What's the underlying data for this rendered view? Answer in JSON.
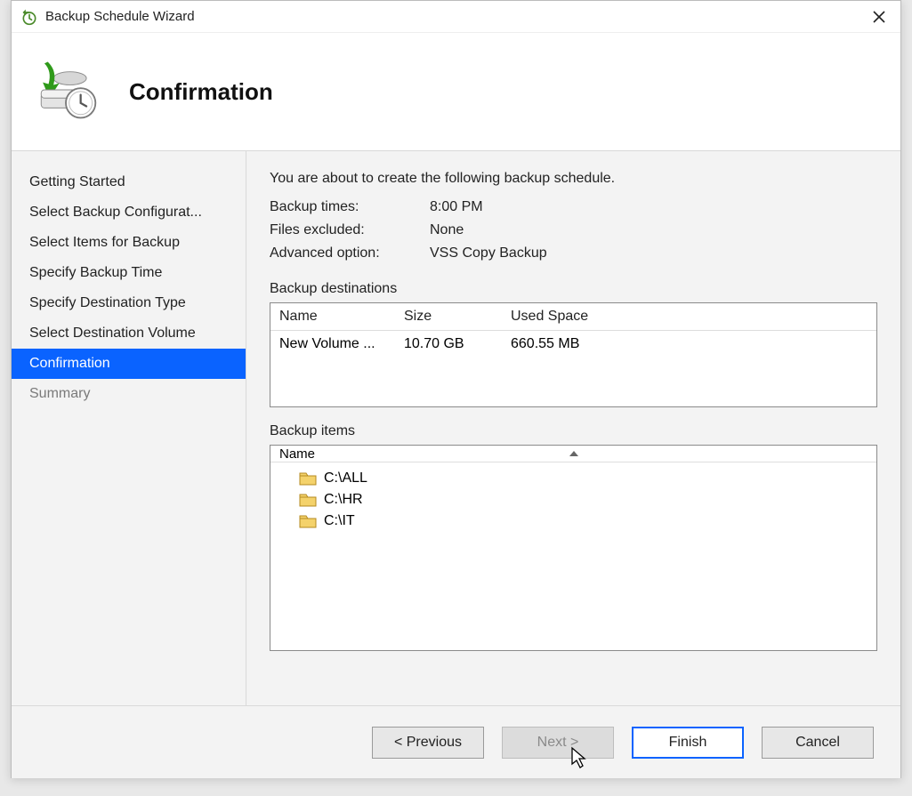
{
  "window": {
    "title": "Backup Schedule Wizard"
  },
  "header": {
    "title": "Confirmation"
  },
  "nav": {
    "steps": [
      {
        "label": "Getting Started",
        "state": "done"
      },
      {
        "label": "Select Backup Configurat...",
        "state": "done"
      },
      {
        "label": "Select Items for Backup",
        "state": "done"
      },
      {
        "label": "Specify Backup Time",
        "state": "done"
      },
      {
        "label": "Specify Destination Type",
        "state": "done"
      },
      {
        "label": "Select Destination Volume",
        "state": "done"
      },
      {
        "label": "Confirmation",
        "state": "active"
      },
      {
        "label": "Summary",
        "state": "after"
      }
    ]
  },
  "content": {
    "intro": "You are about to create the following backup schedule.",
    "kv": {
      "backup_times_label": "Backup times:",
      "backup_times_value": "8:00 PM",
      "files_excluded_label": "Files excluded:",
      "files_excluded_value": "None",
      "advanced_option_label": "Advanced option:",
      "advanced_option_value": "VSS Copy Backup"
    },
    "destinations": {
      "section_label": "Backup destinations",
      "columns": {
        "name": "Name",
        "size": "Size",
        "used": "Used Space"
      },
      "rows": [
        {
          "name": "New Volume ...",
          "size": "10.70 GB",
          "used": "660.55 MB"
        }
      ]
    },
    "items": {
      "section_label": "Backup items",
      "column_name": "Name",
      "rows": [
        {
          "path": "C:\\ALL"
        },
        {
          "path": "C:\\HR"
        },
        {
          "path": "C:\\IT"
        }
      ]
    }
  },
  "footer": {
    "previous": "< Previous",
    "next": "Next >",
    "finish": "Finish",
    "cancel": "Cancel"
  }
}
